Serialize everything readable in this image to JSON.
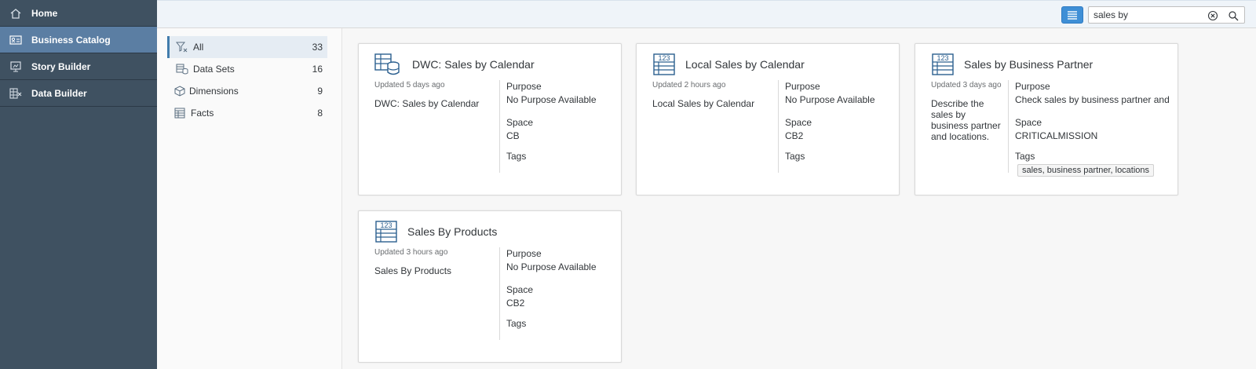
{
  "sidebar": {
    "items": [
      {
        "label": "Home",
        "icon": "home-icon"
      },
      {
        "label": "Business Catalog",
        "icon": "catalog-icon"
      },
      {
        "label": "Story Builder",
        "icon": "presentation-icon"
      },
      {
        "label": "Data Builder",
        "icon": "data-builder-icon"
      }
    ]
  },
  "topbar": {
    "search": {
      "value": "sales by",
      "clear_icon": "clear-icon",
      "search_icon": "search-icon"
    }
  },
  "filters": [
    {
      "label": "All",
      "count": "33",
      "icon": "filter-clear-icon"
    },
    {
      "label": "Data Sets",
      "count": "16",
      "icon": "datasets-icon"
    },
    {
      "label": "Dimensions",
      "count": "9",
      "icon": "dimension-cube-icon"
    },
    {
      "label": "Facts",
      "count": "8",
      "icon": "facts-icon"
    }
  ],
  "labels": {
    "purpose": "Purpose",
    "space": "Space",
    "tags": "Tags"
  },
  "cards": [
    {
      "title": "DWC: Sales by Calendar",
      "icon": "dataset-database-icon",
      "updated": "Updated 5 days ago",
      "description": "DWC: Sales by Calendar",
      "purpose": "No Purpose Available",
      "space": "CB",
      "tags": ""
    },
    {
      "title": "Local Sales by Calendar",
      "icon": "fact-table-123-icon",
      "updated": "Updated 2 hours ago",
      "description": "Local Sales by Calendar",
      "purpose": "No Purpose Available",
      "space": "CB2",
      "tags": ""
    },
    {
      "title": "Sales by Business Partner",
      "icon": "fact-table-123-icon",
      "updated": "Updated 3 days ago",
      "description": "Describe the sales by business partner and locations.",
      "purpose": "Check sales by business partner and lo",
      "space": "CRITICALMISSION",
      "tags": "sales, business partner, locations"
    },
    {
      "title": "Sales By Products",
      "icon": "fact-table-123-icon",
      "updated": "Updated 3 hours ago",
      "description": "Sales By Products",
      "purpose": "No Purpose Available",
      "space": "CB2",
      "tags": ""
    }
  ],
  "colors": {
    "sidebar_bg": "#3f5161",
    "sidebar_active": "#5b7ea3",
    "accent": "#3f8fd6",
    "icon_blue": "#2b5f8f"
  }
}
